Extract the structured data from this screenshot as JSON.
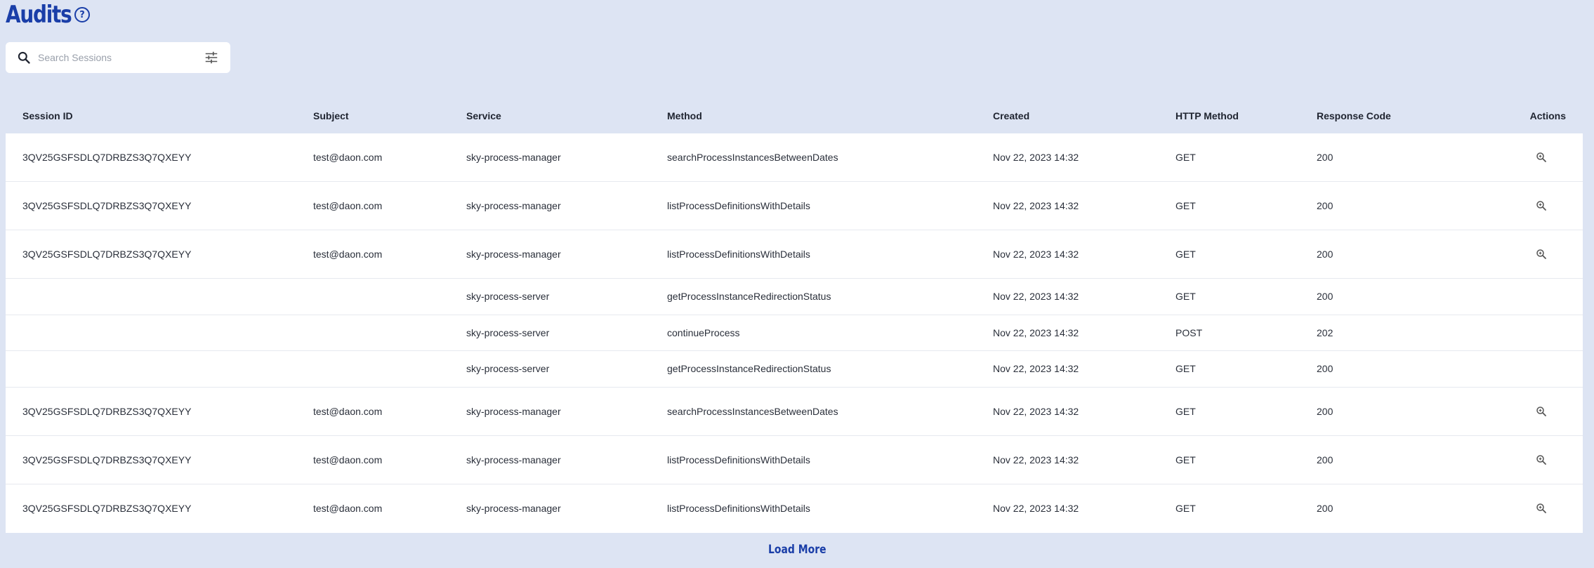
{
  "header": {
    "title": "Audits",
    "help_glyph": "?",
    "help_icon": "help-circle-icon"
  },
  "search": {
    "placeholder": "Search Sessions",
    "value": "",
    "search_icon": "search-icon",
    "filter_icon": "sliders-icon"
  },
  "table": {
    "columns": [
      "Session ID",
      "Subject",
      "Service",
      "Method",
      "Created",
      "HTTP Method",
      "Response Code",
      "Actions"
    ],
    "rows": [
      {
        "type": "main",
        "session_id": "3QV25GSFSDLQ7DRBZS3Q7QXEYY",
        "subject": "test@daon.com",
        "service": "sky-process-manager",
        "method": "searchProcessInstancesBetweenDates",
        "created": "Nov 22, 2023 14:32",
        "http_method": "GET",
        "response_code": "200",
        "action_icon": "magnify-icon"
      },
      {
        "type": "main",
        "session_id": "3QV25GSFSDLQ7DRBZS3Q7QXEYY",
        "subject": "test@daon.com",
        "service": "sky-process-manager",
        "method": "listProcessDefinitionsWithDetails",
        "created": "Nov 22, 2023 14:32",
        "http_method": "GET",
        "response_code": "200",
        "action_icon": "magnify-icon"
      },
      {
        "type": "main",
        "session_id": "3QV25GSFSDLQ7DRBZS3Q7QXEYY",
        "subject": "test@daon.com",
        "service": "sky-process-manager",
        "method": "listProcessDefinitionsWithDetails",
        "created": "Nov 22, 2023 14:32",
        "http_method": "GET",
        "response_code": "200",
        "action_icon": "magnify-icon"
      },
      {
        "type": "sub",
        "session_id": "",
        "subject": "",
        "service": "sky-process-server",
        "method": "getProcessInstanceRedirectionStatus",
        "created": "Nov 22, 2023 14:32",
        "http_method": "GET",
        "response_code": "200"
      },
      {
        "type": "sub",
        "session_id": "",
        "subject": "",
        "service": "sky-process-server",
        "method": "continueProcess",
        "created": "Nov 22, 2023 14:32",
        "http_method": "POST",
        "response_code": "202"
      },
      {
        "type": "sub",
        "session_id": "",
        "subject": "",
        "service": "sky-process-server",
        "method": "getProcessInstanceRedirectionStatus",
        "created": "Nov 22, 2023 14:32",
        "http_method": "GET",
        "response_code": "200"
      },
      {
        "type": "main",
        "session_id": "3QV25GSFSDLQ7DRBZS3Q7QXEYY",
        "subject": "test@daon.com",
        "service": "sky-process-manager",
        "method": "searchProcessInstancesBetweenDates",
        "created": "Nov 22, 2023 14:32",
        "http_method": "GET",
        "response_code": "200",
        "action_icon": "magnify-icon"
      },
      {
        "type": "main",
        "session_id": "3QV25GSFSDLQ7DRBZS3Q7QXEYY",
        "subject": "test@daon.com",
        "service": "sky-process-manager",
        "method": "listProcessDefinitionsWithDetails",
        "created": "Nov 22, 2023 14:32",
        "http_method": "GET",
        "response_code": "200",
        "action_icon": "magnify-icon"
      },
      {
        "type": "main",
        "session_id": "3QV25GSFSDLQ7DRBZS3Q7QXEYY",
        "subject": "test@daon.com",
        "service": "sky-process-manager",
        "method": "listProcessDefinitionsWithDetails",
        "created": "Nov 22, 2023 14:32",
        "http_method": "GET",
        "response_code": "200",
        "action_icon": "magnify-icon"
      }
    ]
  },
  "footer": {
    "load_more_label": "Load More"
  },
  "colors": {
    "background": "#dde4f3",
    "accent": "#1a3ea8",
    "table_bg": "#ffffff"
  }
}
